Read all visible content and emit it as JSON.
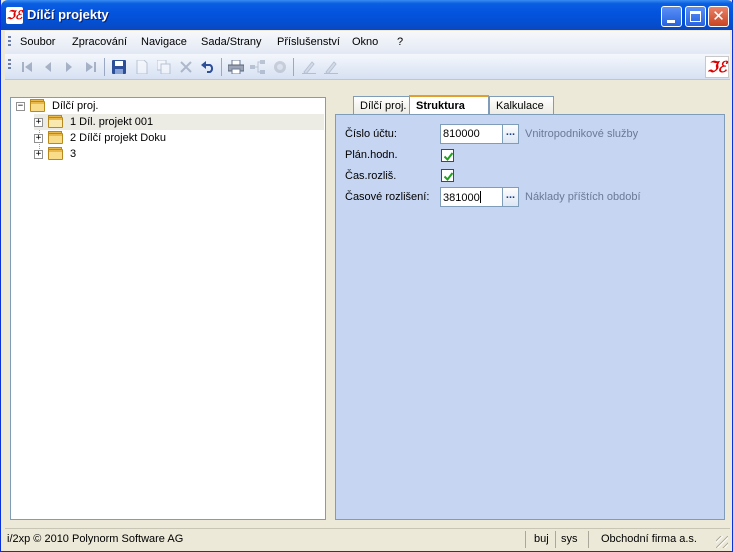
{
  "window": {
    "title": "Dílčí projekty",
    "logo_text": "ℑℰ"
  },
  "menu": {
    "items": [
      "Soubor",
      "Zpracování",
      "Navigace",
      "Sada/Strany",
      "Příslušenství",
      "Okno",
      "?"
    ]
  },
  "toolbar": {
    "icons": [
      "first-icon",
      "prev-icon",
      "next-icon",
      "last-icon",
      "save-icon",
      "new-icon",
      "copy-icon",
      "delete-icon",
      "undo-icon",
      "print-icon",
      "structure-icon",
      "refresh-icon",
      "edit-icon",
      "edit-alt-icon"
    ]
  },
  "tree": {
    "root": "Dílčí proj.",
    "children": [
      "1 Díl. projekt 001",
      "2 Dílčí projekt Doku",
      "3"
    ]
  },
  "tabs": {
    "items": [
      "Dílčí proj.",
      "Struktura",
      "Kalkulace"
    ],
    "active": "Struktura"
  },
  "form": {
    "account_label": "Číslo účtu:",
    "account_value": "810000",
    "account_hint": "Vnitropodnikové služby",
    "plan_label": "Plán.hodn.",
    "plan_checked": true,
    "time_label": "Čas.rozliš.",
    "time_checked": true,
    "accrual_label": "Časové rozlišení:",
    "accrual_value": "381000",
    "accrual_hint": "Náklady příštích období",
    "browse_label": "..."
  },
  "status": {
    "copyright": "i/2xp © 2010 Polynorm Software AG",
    "user": "buj",
    "db": "sys",
    "company": "Obchodní firma a.s."
  },
  "colors": {
    "titlebar": "#0554e0",
    "content_bg": "#c6d6f2",
    "accent_red": "#dd0000"
  }
}
